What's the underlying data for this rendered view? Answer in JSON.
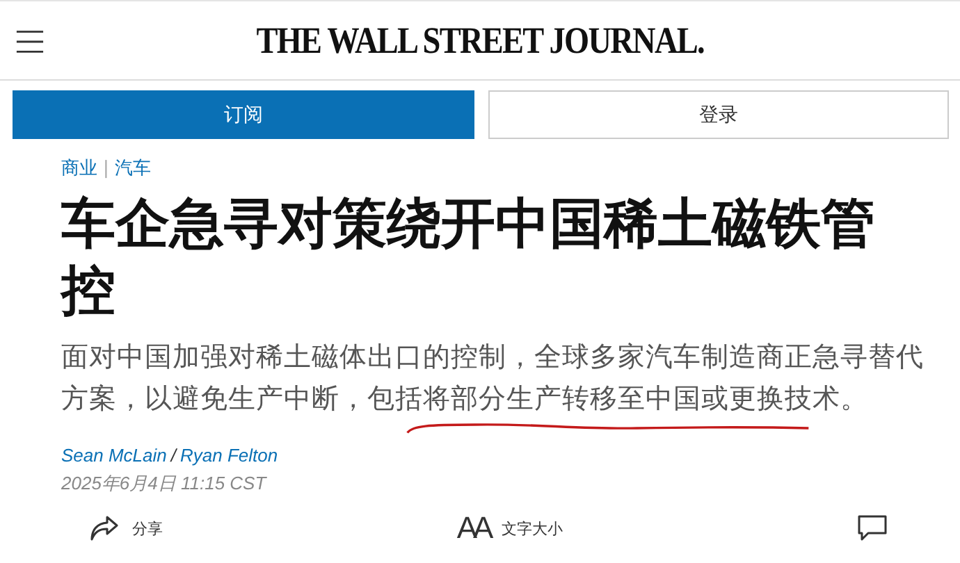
{
  "header": {
    "logo": "THE WALL STREET JOURNAL."
  },
  "buttons": [
    {
      "label": "订阅",
      "kind": "primary"
    },
    {
      "label": "登录",
      "kind": "secondary"
    }
  ],
  "breadcrumb": [
    "商业",
    "|",
    "汽车"
  ],
  "headline": "车企急寻对策绕开中国稀土磁铁管控",
  "summary": "面对中国加强对稀土磁体出口的控制，全球多家汽车制造商正急寻替代方案，以避免生产中断，包括将部分生产转移至中国或更换技术。",
  "authors": [
    "Sean McLain",
    "/",
    "Ryan Felton"
  ],
  "date": "2025年6月4日 11:15 CST",
  "toolbar": [
    {
      "kind": "share",
      "label": "分享"
    },
    {
      "kind": "text-size",
      "icon_text": "AA",
      "label": "文字大小"
    },
    {
      "kind": "comment"
    }
  ]
}
